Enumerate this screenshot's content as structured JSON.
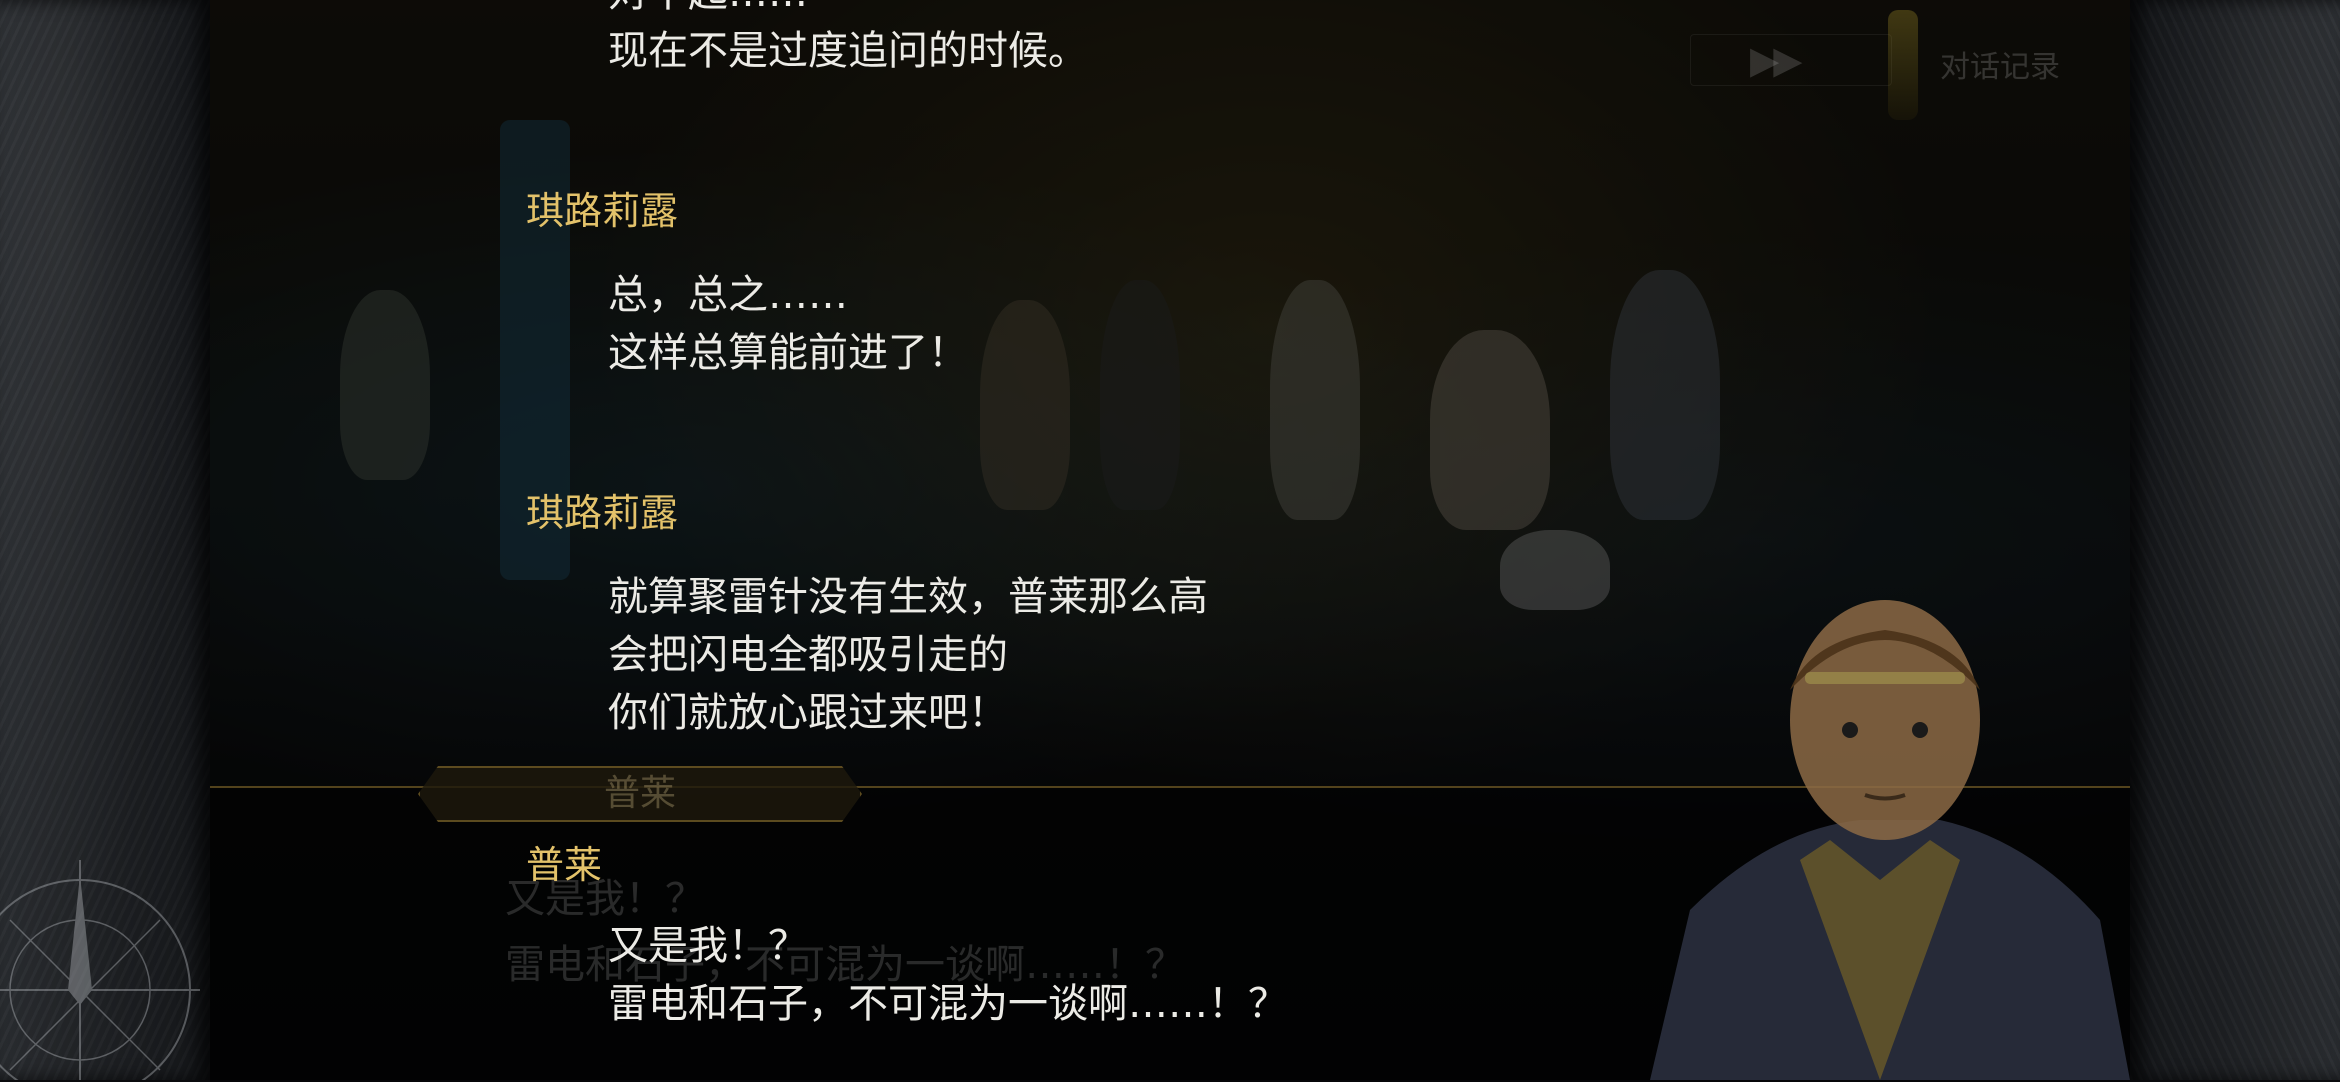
{
  "controls": {
    "fast_forward_glyph": "▶▶",
    "log_label": "对话记录"
  },
  "background_dialogue": {
    "name": "普莱",
    "line1": "又是我！？",
    "line2": "雷电和石子，不可混为一谈啊……！？"
  },
  "log": [
    {
      "speaker": "",
      "lines": "对不起……\n现在不是过度追问的时候。"
    },
    {
      "speaker": "琪路莉露",
      "lines": "总，总之……\n这样总算能前进了！"
    },
    {
      "speaker": "琪路莉露",
      "lines": "就算聚雷针没有生效，普莱那么高\n会把闪电全都吸引走的\n你们就放心跟过来吧！"
    },
    {
      "speaker": "普莱",
      "lines": "又是我！？\n雷电和石子，不可混为一谈啊……！？"
    }
  ],
  "colors": {
    "speaker": "#e3c26a",
    "text": "#ecebe6"
  }
}
